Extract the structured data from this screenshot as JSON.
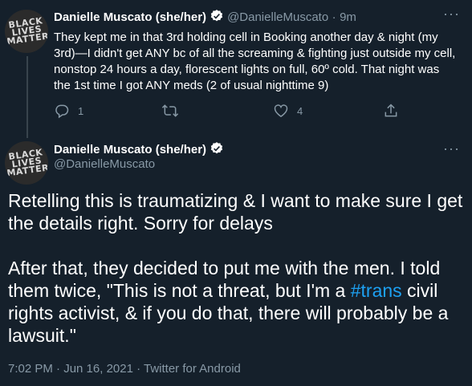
{
  "tweet1": {
    "avatar_text": [
      "BLACK",
      "LIVES",
      "MATTER"
    ],
    "display_name": "Danielle Muscato (she/her)",
    "handle": "@DanielleMuscato",
    "separator": "·",
    "time": "9m",
    "more_icon": "more-dots-icon",
    "text": "They kept me in that 3rd holding cell in Booking another day & night (my 3rd)—I didn't get ANY bc of all the screaming & fighting just outside my cell, nonstop 24 hours a day, florescent lights on full, 60º cold. That night was the 1st time I got ANY meds (2 of usual nighttime 9)",
    "actions": {
      "reply_count": "1",
      "retweet_count": "",
      "like_count": "4"
    }
  },
  "tweet2": {
    "avatar_text": [
      "BLACK",
      "LIVES",
      "MATTER"
    ],
    "display_name": "Danielle Muscato (she/her)",
    "handle": "@DanielleMuscato",
    "more_icon": "more-dots-icon",
    "paragraph1": "Retelling this is traumatizing & I want to make sure I get the details right. Sorry for delays",
    "paragraph2_before": "After that, they decided to put me with the men. I told them twice, \"This is not a threat, but I'm a ",
    "hashtag": "#trans",
    "paragraph2_after": " civil rights activist, & if you do that, there will probably be a lawsuit.\"",
    "meta": "7:02 PM · Jun 16, 2021 · Twitter for Android"
  },
  "colors": {
    "background": "#15202b",
    "text": "#ffffff",
    "secondary": "#8899a6",
    "accent": "#1da1f2"
  }
}
